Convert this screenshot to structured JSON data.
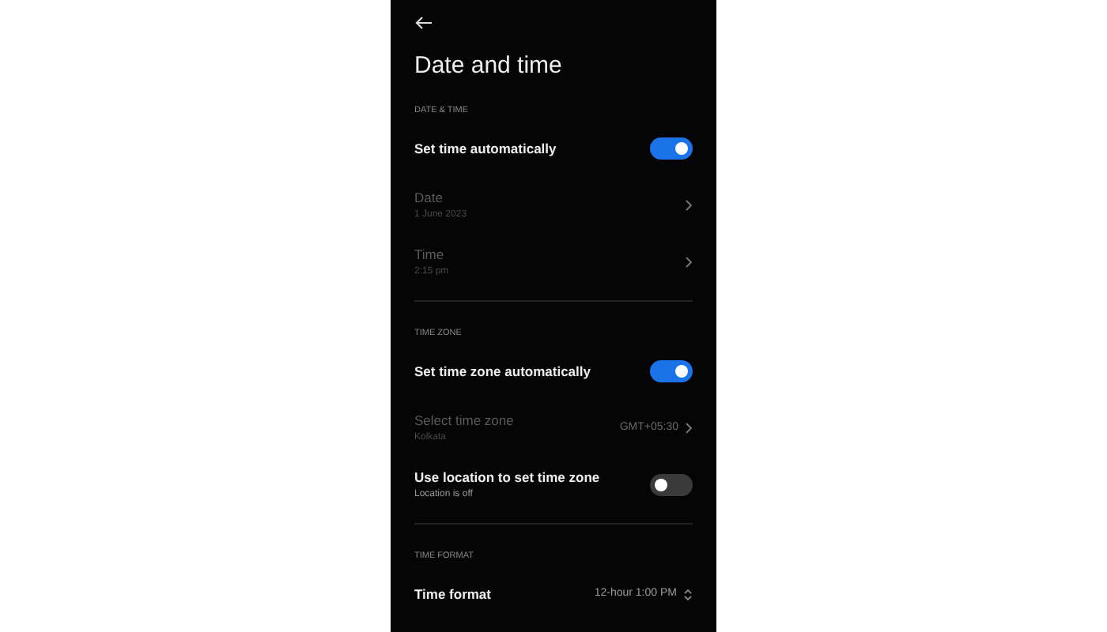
{
  "header": {
    "title": "Date and time"
  },
  "sections": [
    {
      "label": "DATE & TIME",
      "items": [
        {
          "kind": "toggle",
          "title": "Set time automatically",
          "on": true
        },
        {
          "kind": "nav",
          "title": "Date",
          "subtitle": "1 June 2023",
          "disabled": true
        },
        {
          "kind": "nav",
          "title": "Time",
          "subtitle": "2:15 pm",
          "disabled": true
        }
      ]
    },
    {
      "label": "TIME ZONE",
      "items": [
        {
          "kind": "toggle",
          "title": "Set time zone automatically",
          "on": true
        },
        {
          "kind": "nav",
          "title": "Select time zone",
          "subtitle": "Kolkata",
          "value": "GMT+05:30",
          "disabled": true
        },
        {
          "kind": "toggle",
          "title": "Use location to set time zone",
          "subtitle": "Location is off",
          "on": false
        }
      ]
    },
    {
      "label": "TIME FORMAT",
      "items": [
        {
          "kind": "select",
          "title": "Time format",
          "value": "12-hour 1:00 PM"
        }
      ]
    }
  ]
}
